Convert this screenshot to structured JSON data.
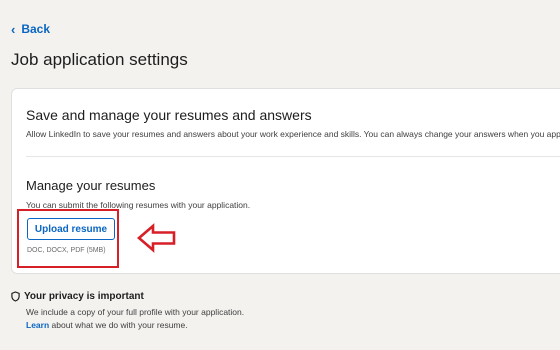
{
  "nav": {
    "back_label": "Back"
  },
  "page": {
    "title": "Job application settings"
  },
  "sections": {
    "save": {
      "title": "Save and manage your resumes and answers",
      "description": "Allow LinkedIn to save your resumes and answers about your work experience and skills. You can always change your answers when you apply."
    },
    "manage": {
      "title": "Manage your resumes",
      "description": "You can submit the following resumes with your application.",
      "upload_button": "Upload resume",
      "file_types": "DOC, DOCX, PDF (5MB)"
    }
  },
  "privacy": {
    "title": "Your privacy is important",
    "line1": "We include a copy of your full profile with your application.",
    "learn_link": "Learn",
    "line2_rest": " about what we do with your resume."
  },
  "colors": {
    "accent": "#0a66c2",
    "annotation": "#d61f26",
    "background": "#f3f2ef"
  },
  "icons": {
    "back": "chevron-left-icon",
    "privacy": "shield-icon",
    "annotation": "arrow-left-icon"
  }
}
